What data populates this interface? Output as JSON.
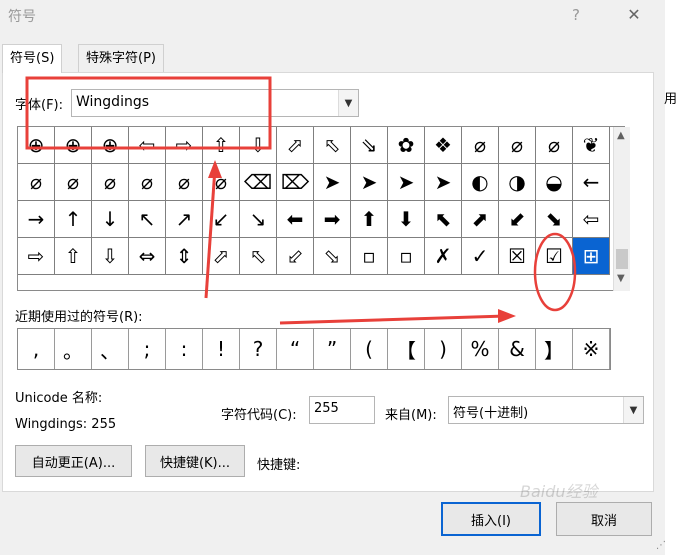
{
  "window": {
    "title": "符号",
    "help": "?",
    "close": "✕"
  },
  "tabs": [
    {
      "label": "符号(S)",
      "active": true
    },
    {
      "label": "特殊字符(P)",
      "active": false
    }
  ],
  "font": {
    "label": "字体(F):",
    "value": "Wingdings"
  },
  "symbol_grid": {
    "rows": [
      [
        "⊕",
        "⊕",
        "⊕",
        "⇦",
        "⇨",
        "⇧",
        "⇩",
        "⬀",
        "⬁",
        "⇘",
        "✿",
        "❖",
        "⌀",
        "⌀",
        "⌀",
        "❦"
      ],
      [
        "⌀",
        "⌀",
        "⌀",
        "⌀",
        "⌀",
        "⌀",
        "⌫",
        "⌦",
        "➤",
        "➤",
        "➤",
        "➤",
        "◐",
        "◑",
        "◒",
        "←"
      ],
      [
        "→",
        "↑",
        "↓",
        "↖",
        "↗",
        "↙",
        "↘",
        "⬅",
        "➡",
        "⬆",
        "⬇",
        "⬉",
        "⬈",
        "⬋",
        "⬊",
        "⇦"
      ],
      [
        "⇨",
        "⇧",
        "⇩",
        "⇔",
        "⇕",
        "⬀",
        "⬁",
        "⬃",
        "⬂",
        "▫",
        "▫",
        "✗",
        "✓",
        "☒",
        "☑",
        "⊞"
      ]
    ],
    "selected": [
      3,
      15
    ]
  },
  "recent": {
    "label": "近期使用过的符号(R):",
    "symbols": [
      ",",
      "。",
      "、",
      ";",
      ":",
      "!",
      "?",
      "“",
      "”",
      "(",
      "【",
      ")",
      "%",
      "&",
      "】",
      "※"
    ]
  },
  "unicode": {
    "label": "Unicode 名称:",
    "value": "Wingdings: 255"
  },
  "char_code": {
    "label": "字符代码(C):",
    "value": "255"
  },
  "from": {
    "label": "来自(M):",
    "value": "符号(十进制)"
  },
  "buttons": {
    "autocorrect": "自动更正(A)...",
    "shortcut_key": "快捷键(K)...",
    "insert": "插入(I)",
    "cancel": "取消"
  },
  "shortcut": {
    "label": "快捷键:"
  },
  "right_edge_text": "用",
  "watermark": "Baidu经验",
  "colors": {
    "selection": "#0a64d2",
    "annotation": "#e8403a"
  }
}
